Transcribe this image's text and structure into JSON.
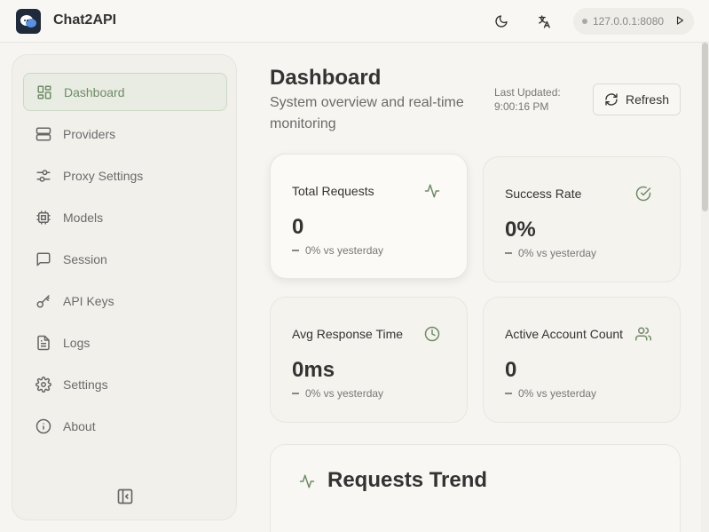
{
  "app": {
    "title": "Chat2API"
  },
  "header": {
    "server": "127.0.0.1:8080"
  },
  "sidebar": {
    "items": [
      {
        "label": "Dashboard",
        "icon": "dashboard-icon",
        "active": true
      },
      {
        "label": "Providers",
        "icon": "server-icon"
      },
      {
        "label": "Proxy Settings",
        "icon": "sliders-icon"
      },
      {
        "label": "Models",
        "icon": "chip-icon"
      },
      {
        "label": "Session",
        "icon": "chat-icon"
      },
      {
        "label": "API Keys",
        "icon": "key-icon"
      },
      {
        "label": "Logs",
        "icon": "document-icon"
      },
      {
        "label": "Settings",
        "icon": "gear-icon"
      },
      {
        "label": "About",
        "icon": "info-icon"
      }
    ]
  },
  "main": {
    "title": "Dashboard",
    "subtitle": "System overview and real-time monitoring",
    "last_updated_label": "Last Updated:",
    "last_updated_time": "9:00:16 PM",
    "refresh_label": "Refresh",
    "stats": [
      {
        "title": "Total Requests",
        "value": "0",
        "trend": "0% vs yesterday",
        "icon": "activity-icon"
      },
      {
        "title": "Success Rate",
        "value": "0%",
        "trend": "0% vs yesterday",
        "icon": "check-circle-icon"
      },
      {
        "title": "Avg Response Time",
        "value": "0ms",
        "trend": "0% vs yesterday",
        "icon": "clock-icon"
      },
      {
        "title": "Active Account Count",
        "value": "0",
        "trend": "0% vs yesterday",
        "icon": "users-icon"
      }
    ],
    "trend_title": "Requests Trend"
  },
  "colors": {
    "accent": "#6f8b68",
    "active_bg": "#e8ece2",
    "background": "#f6f5f1"
  }
}
